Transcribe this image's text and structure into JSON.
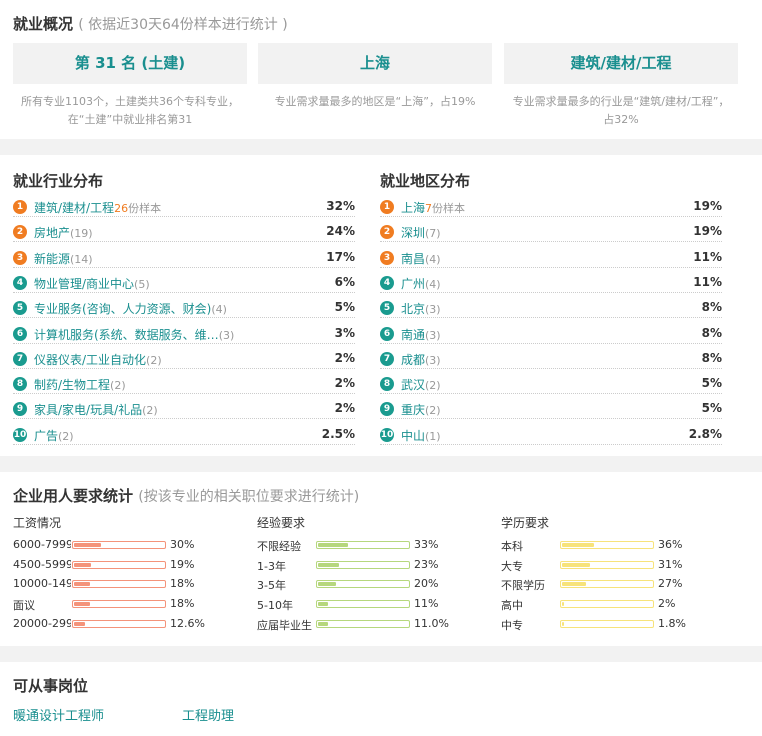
{
  "overview": {
    "title": "就业概况",
    "subtitle": "( 依据近30天64份样本进行统计 )",
    "boxes": [
      {
        "label": "第 31 名 (土建)",
        "desc": "所有专业1103个，土建类共36个专科专业，在“土建”中就业排名第31"
      },
      {
        "label": "上海",
        "desc": "专业需求量最多的地区是“上海”，占19%"
      },
      {
        "label": "建筑/建材/工程",
        "desc": "专业需求量最多的行业是“建筑/建材/工程”，占32%"
      }
    ]
  },
  "industry": {
    "title": "就业行业分布",
    "items": [
      {
        "rank": "1",
        "name": "建筑/建材/工程",
        "count": "26",
        "sample": "份样本",
        "pct": "32%"
      },
      {
        "rank": "2",
        "name": "房地产",
        "count": "(19)",
        "pct": "24%"
      },
      {
        "rank": "3",
        "name": "新能源",
        "count": "(14)",
        "pct": "17%"
      },
      {
        "rank": "4",
        "name": "物业管理/商业中心",
        "count": "(5)",
        "pct": "6%"
      },
      {
        "rank": "5",
        "name": "专业服务(咨询、人力资源、财会)",
        "count": "(4)",
        "pct": "5%"
      },
      {
        "rank": "6",
        "name": "计算机服务(系统、数据服务、维…",
        "count": "(3)",
        "pct": "3%"
      },
      {
        "rank": "7",
        "name": "仪器仪表/工业自动化",
        "count": "(2)",
        "pct": "2%"
      },
      {
        "rank": "8",
        "name": "制药/生物工程",
        "count": "(2)",
        "pct": "2%"
      },
      {
        "rank": "9",
        "name": "家具/家电/玩具/礼品",
        "count": "(2)",
        "pct": "2%"
      },
      {
        "rank": "10",
        "name": "广告",
        "count": "(2)",
        "pct": "2.5%"
      }
    ]
  },
  "region": {
    "title": "就业地区分布",
    "items": [
      {
        "rank": "1",
        "name": "上海",
        "count": "7",
        "sample": "份样本",
        "pct": "19%"
      },
      {
        "rank": "2",
        "name": "深圳",
        "count": "(7)",
        "pct": "19%"
      },
      {
        "rank": "3",
        "name": "南昌",
        "count": "(4)",
        "pct": "11%"
      },
      {
        "rank": "4",
        "name": "广州",
        "count": "(4)",
        "pct": "11%"
      },
      {
        "rank": "5",
        "name": "北京",
        "count": "(3)",
        "pct": "8%"
      },
      {
        "rank": "6",
        "name": "南通",
        "count": "(3)",
        "pct": "8%"
      },
      {
        "rank": "7",
        "name": "成都",
        "count": "(3)",
        "pct": "8%"
      },
      {
        "rank": "8",
        "name": "武汉",
        "count": "(2)",
        "pct": "5%"
      },
      {
        "rank": "9",
        "name": "重庆",
        "count": "(2)",
        "pct": "5%"
      },
      {
        "rank": "10",
        "name": "中山",
        "count": "(1)",
        "pct": "2.8%"
      }
    ]
  },
  "requirements": {
    "title": "企业用人要求统计",
    "subtitle": "(按该专业的相关职位要求进行统计)",
    "groups": [
      {
        "title": "工资情况",
        "color": "#f4937a",
        "items": [
          {
            "label": "6000-7999",
            "pct": "30%",
            "value": 30
          },
          {
            "label": "4500-5999",
            "pct": "19%",
            "value": 19
          },
          {
            "label": "10000-149",
            "pct": "18%",
            "value": 18
          },
          {
            "label": "面议",
            "pct": "18%",
            "value": 18
          },
          {
            "label": "20000-299",
            "pct": "12.6%",
            "value": 12.6
          }
        ]
      },
      {
        "title": "经验要求",
        "color": "#b6d77d",
        "items": [
          {
            "label": "不限经验",
            "pct": "33%",
            "value": 33
          },
          {
            "label": "1-3年",
            "pct": "23%",
            "value": 23
          },
          {
            "label": "3-5年",
            "pct": "20%",
            "value": 20
          },
          {
            "label": "5-10年",
            "pct": "11%",
            "value": 11
          },
          {
            "label": "应届毕业生",
            "pct": "11.0%",
            "value": 11.0
          }
        ]
      },
      {
        "title": "学历要求",
        "color": "#f7e37b",
        "items": [
          {
            "label": "本科",
            "pct": "36%",
            "value": 36
          },
          {
            "label": "大专",
            "pct": "31%",
            "value": 31
          },
          {
            "label": "不限学历",
            "pct": "27%",
            "value": 27
          },
          {
            "label": "高中",
            "pct": "2%",
            "value": 2
          },
          {
            "label": "中专",
            "pct": "1.8%",
            "value": 1.8
          }
        ]
      }
    ]
  },
  "jobs": {
    "title": "可从事岗位",
    "items": [
      "暖通设计工程师",
      "工程助理"
    ]
  },
  "colors": {
    "accent_teal": "#1a8f8f",
    "rank_orange": "#f07c21",
    "rank_teal": "#1a9b8f"
  }
}
